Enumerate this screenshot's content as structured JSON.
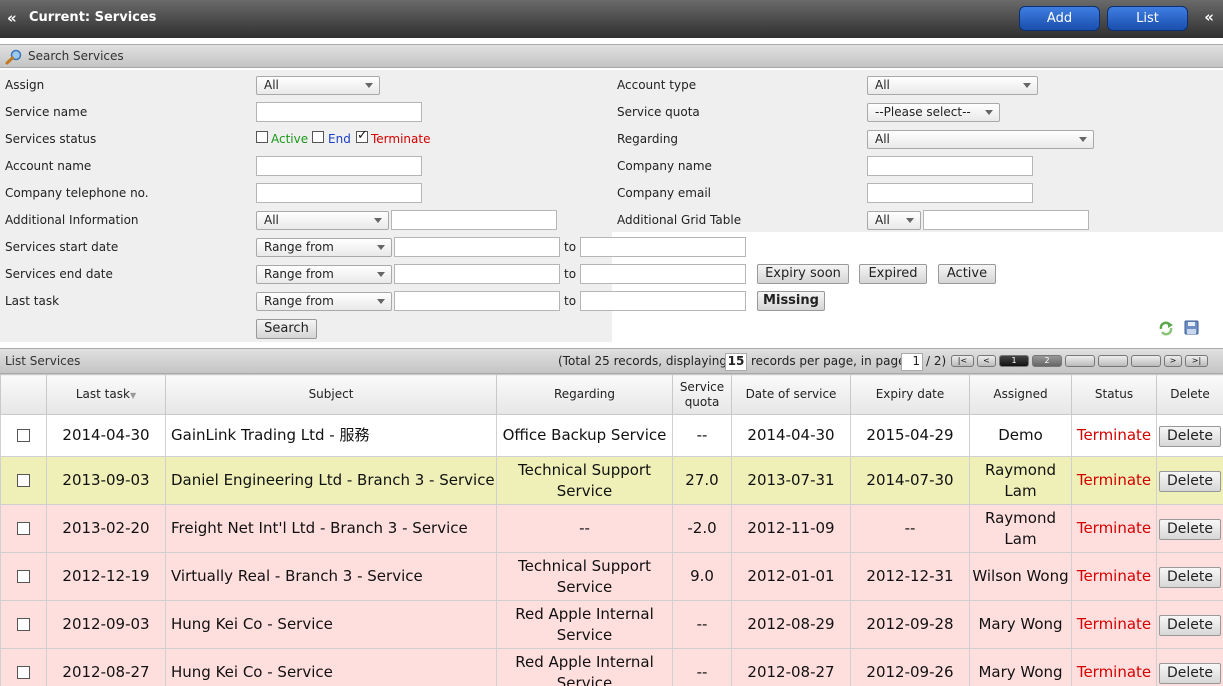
{
  "header": {
    "title": "Current: Services",
    "add_label": "Add",
    "list_label": "List"
  },
  "search": {
    "section_title": "Search Services",
    "assign_label": "Assign",
    "assign_value": "All",
    "service_name_label": "Service name",
    "status_label": "Services status",
    "status_active": "Active",
    "status_end": "End",
    "status_terminate": "Terminate",
    "account_name_label": "Account name",
    "company_tel_label": "Company telephone no.",
    "additional_info_label": "Additional Information",
    "additional_info_value": "All",
    "start_date_label": "Services start date",
    "end_date_label": "Services end date",
    "last_task_label": "Last task",
    "range_from": "Range from",
    "to": "to",
    "account_type_label": "Account type",
    "account_type_value": "All",
    "service_quota_label": "Service quota",
    "service_quota_value": "--Please select--",
    "regarding_label": "Regarding",
    "regarding_value": "All",
    "company_name_label": "Company name",
    "company_email_label": "Company email",
    "grid_table_label": "Additional Grid Table",
    "grid_table_value": "All",
    "expiry_soon_label": "Expiry soon",
    "expired_label": "Expired",
    "active_label": "Active",
    "missing_label": "Missing",
    "search_label": "Search"
  },
  "list": {
    "section_title": "List Services",
    "pager_before": "(Total 25 records, displaying",
    "per_page": "15",
    "pager_middle": "records per page, in page",
    "page": "1",
    "pager_after": "/ 2)",
    "first": "|<",
    "prev": "<",
    "page1": "1",
    "page2": "2",
    "next": ">",
    "last": ">|"
  },
  "columns": {
    "last_task": "Last task",
    "subject": "Subject",
    "regarding": "Regarding",
    "quota_1": "Service",
    "quota_2": "quota",
    "date": "Date of service",
    "expiry": "Expiry date",
    "assigned": "Assigned",
    "status": "Status",
    "delete": "Delete"
  },
  "rows": [
    {
      "last_task": "2014-04-30",
      "subject": "GainLink Trading Ltd - 服務",
      "regarding_1": "Office Backup Service",
      "regarding_2": "",
      "quota": "--",
      "date": "2014-04-30",
      "expiry": "2015-04-29",
      "assigned_1": "Demo",
      "assigned_2": "",
      "status": "Terminate",
      "delete": "Delete"
    },
    {
      "last_task": "2013-09-03",
      "subject": "Daniel Engineering Ltd - Branch 3 - Service",
      "regarding_1": "Technical Support",
      "regarding_2": "Service",
      "quota": "27.0",
      "date": "2013-07-31",
      "expiry": "2014-07-30",
      "assigned_1": "Raymond",
      "assigned_2": "Lam",
      "status": "Terminate",
      "delete": "Delete"
    },
    {
      "last_task": "2013-02-20",
      "subject": "Freight Net Int'l Ltd - Branch 3 - Service",
      "regarding_1": "--",
      "regarding_2": "",
      "quota": "-2.0",
      "date": "2012-11-09",
      "expiry": "--",
      "assigned_1": "Raymond",
      "assigned_2": "Lam",
      "status": "Terminate",
      "delete": "Delete"
    },
    {
      "last_task": "2012-12-19",
      "subject": "Virtually Real - Branch 3 - Service",
      "regarding_1": "Technical Support",
      "regarding_2": "Service",
      "quota": "9.0",
      "date": "2012-01-01",
      "expiry": "2012-12-31",
      "assigned_1": "Wilson Wong",
      "assigned_2": "",
      "status": "Terminate",
      "delete": "Delete"
    },
    {
      "last_task": "2012-09-03",
      "subject": "Hung Kei Co - Service",
      "regarding_1": "Red Apple Internal",
      "regarding_2": "Service",
      "quota": "--",
      "date": "2012-08-29",
      "expiry": "2012-09-28",
      "assigned_1": "Mary Wong",
      "assigned_2": "",
      "status": "Terminate",
      "delete": "Delete"
    },
    {
      "last_task": "2012-08-27",
      "subject": "Hung Kei Co - Service",
      "regarding_1": "Red Apple Internal",
      "regarding_2": "Service",
      "quota": "--",
      "date": "2012-08-27",
      "expiry": "2012-09-26",
      "assigned_1": "Mary Wong",
      "assigned_2": "",
      "status": "Terminate",
      "delete": "Delete"
    }
  ],
  "colors": {
    "active": "#1a9a1a",
    "end": "#1b3fc4",
    "terminate": "#d40000",
    "row_yellow": "#eef0b8",
    "row_pink": "#ffdede"
  }
}
